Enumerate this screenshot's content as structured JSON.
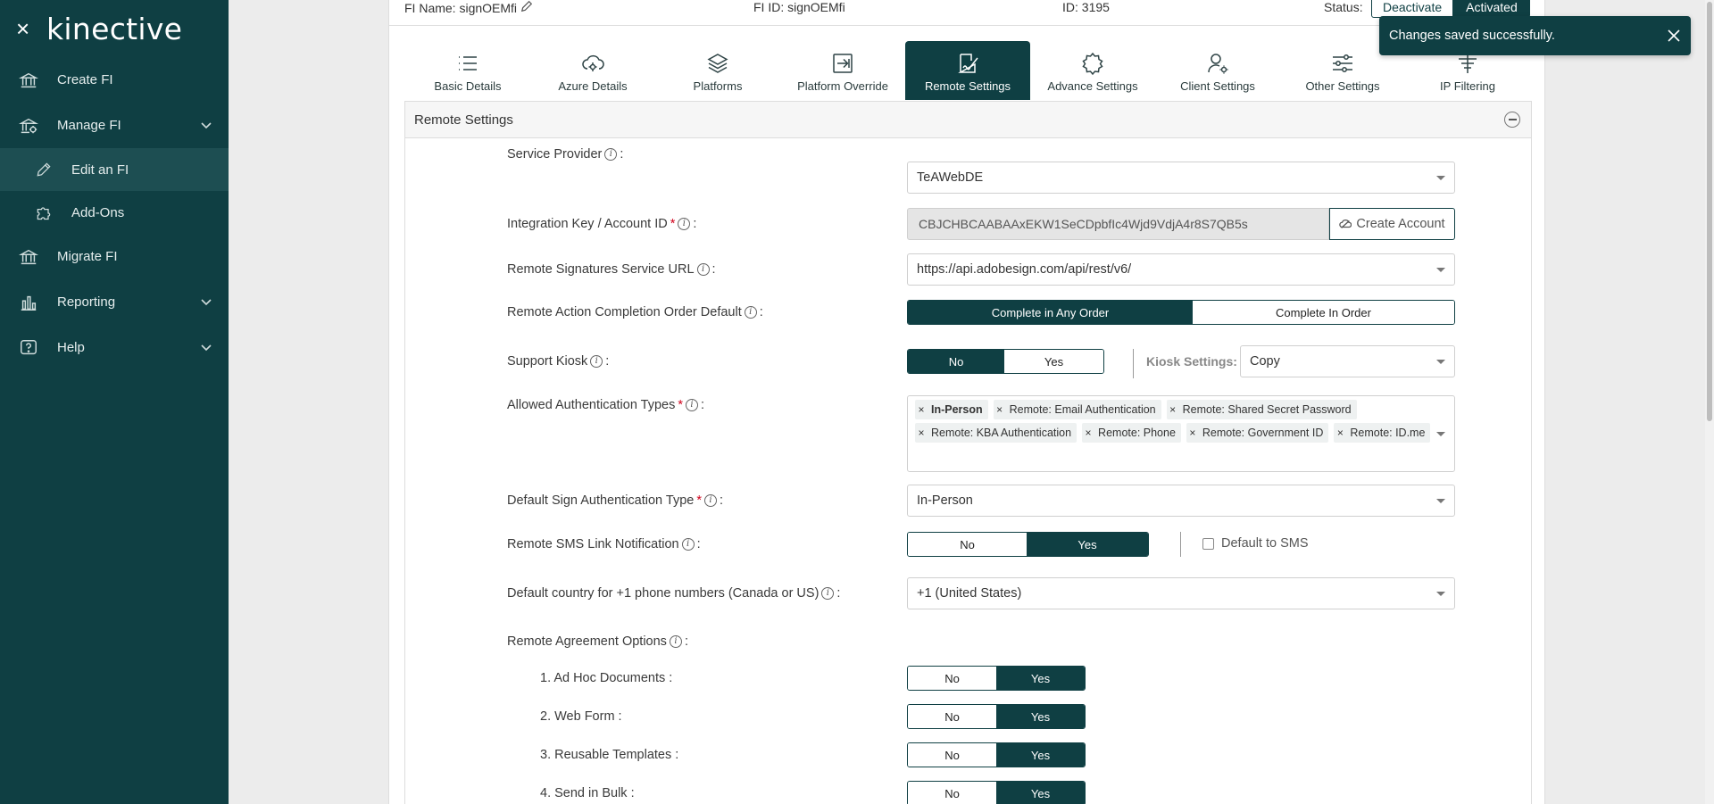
{
  "brand": {
    "close_glyph": "×",
    "logo": "kinective"
  },
  "sidebar": {
    "items": [
      {
        "label": "Create FI",
        "icon": "bank-icon"
      },
      {
        "label": "Manage FI",
        "icon": "bank-gear-icon"
      },
      {
        "label": "Edit an FI",
        "icon": "pencil-icon"
      },
      {
        "label": "Add-Ons",
        "icon": "puzzle-icon"
      },
      {
        "label": "Migrate FI",
        "icon": "bank-icon"
      },
      {
        "label": "Reporting",
        "icon": "bar-chart-icon"
      },
      {
        "label": "Help",
        "icon": "help-icon"
      }
    ]
  },
  "infobar": {
    "fi_name": "FI Name: signOEMfi",
    "fi_id": "FI ID: signOEMfi",
    "id": "ID: 3195",
    "status_label": "Status:",
    "deactivate": "Deactivate",
    "activated": "Activated"
  },
  "tabs": [
    {
      "label": "Basic Details",
      "icon": "list-icon"
    },
    {
      "label": "Azure Details",
      "icon": "cloud-icon"
    },
    {
      "label": "Platforms",
      "icon": "layers-icon"
    },
    {
      "label": "Platform Override",
      "icon": "override-icon"
    },
    {
      "label": "Remote Settings",
      "icon": "remote-sign-icon"
    },
    {
      "label": "Advance Settings",
      "icon": "gear-icon"
    },
    {
      "label": "Client Settings",
      "icon": "user-gear-icon"
    },
    {
      "label": "Other Settings",
      "icon": "sliders-icon"
    },
    {
      "label": "IP Filtering",
      "icon": "filter-icon"
    }
  ],
  "section": {
    "title": "Remote Settings"
  },
  "form": {
    "service_provider": {
      "label": "Service Provider",
      "value": "TeAWebDE"
    },
    "integration_key": {
      "label": "Integration Key / Account ID",
      "required": "*",
      "value": "CBJCHBCAABAAxEKW1SeCDpbfIc4Wjd9VdjA4r8S7QB5s",
      "button": "Create Account"
    },
    "service_url": {
      "label": "Remote Signatures Service URL",
      "value": "https://api.adobesign.com/api/rest/v6/"
    },
    "completion_order": {
      "label": "Remote Action Completion Order Default",
      "option_a": "Complete in Any Order",
      "option_b": "Complete In Order"
    },
    "support_kiosk": {
      "label": "Support Kiosk",
      "no": "No",
      "yes": "Yes",
      "kiosk_label": "Kiosk Settings:",
      "kiosk_value": "Copy"
    },
    "auth_types": {
      "label": "Allowed Authentication Types",
      "required": "*",
      "chips": [
        "In-Person",
        "Remote: Email Authentication",
        "Remote: Shared Secret Password",
        "Remote: KBA Authentication",
        "Remote: Phone",
        "Remote: Government ID",
        "Remote: ID.me"
      ]
    },
    "default_auth": {
      "label": "Default Sign Authentication Type",
      "required": "*",
      "value": "In-Person"
    },
    "sms_link": {
      "label": "Remote SMS Link Notification",
      "no": "No",
      "yes": "Yes",
      "checkbox": "Default to SMS"
    },
    "country": {
      "label": "Default country for +1 phone numbers (Canada or US)",
      "value": "+1 (United States)"
    },
    "agreement": {
      "label": "Remote Agreement Options",
      "options": [
        {
          "label": "1. Ad Hoc Documents :",
          "no": "No",
          "yes": "Yes"
        },
        {
          "label": "2. Web Form :",
          "no": "No",
          "yes": "Yes"
        },
        {
          "label": "3. Reusable Templates :",
          "no": "No",
          "yes": "Yes"
        },
        {
          "label": "4. Send in Bulk :",
          "no": "No",
          "yes": "Yes"
        }
      ]
    },
    "colon": ":"
  },
  "toast": {
    "message": "Changes saved successfully."
  },
  "colors": {
    "primary": "#0f3f43",
    "required": "#d0021b"
  }
}
